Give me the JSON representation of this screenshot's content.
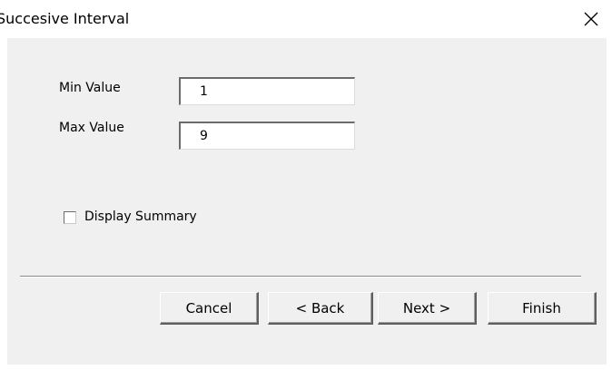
{
  "window": {
    "title": "Succesive Interval",
    "close_icon": "close-icon"
  },
  "form": {
    "min_label": "Min Value",
    "min_value": "1",
    "max_label": "Max Value",
    "max_value": "9"
  },
  "options": {
    "display_summary_label": "Display Summary",
    "display_summary_checked": false
  },
  "buttons": {
    "cancel": "Cancel",
    "back": "< Back",
    "next": "Next >",
    "finish": "Finish"
  }
}
